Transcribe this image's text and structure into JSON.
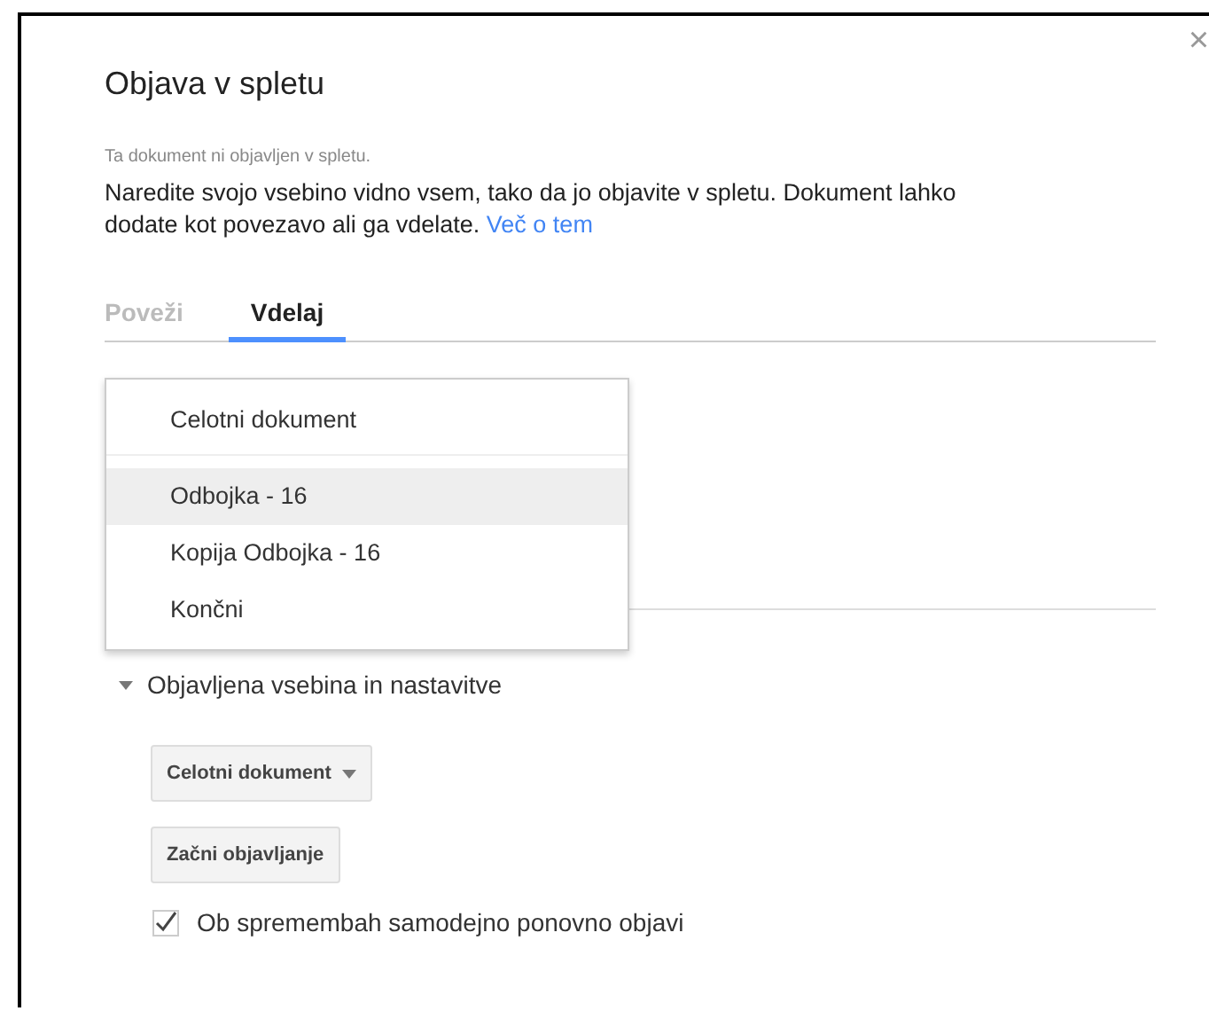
{
  "dialog": {
    "title": "Objava v spletu",
    "close": "×",
    "status": "Ta dokument ni objavljen v spletu.",
    "description": "Naredite svojo vsebino vidno vsem, tako da jo objavite v spletu. Dokument lahko dodate kot povezavo ali ga vdelate.",
    "link": "Več o tem"
  },
  "tabs": [
    {
      "label": "Poveži",
      "selected": false
    },
    {
      "label": "Vdelaj",
      "selected": true
    }
  ],
  "menu": {
    "items": [
      {
        "label": "Celotni dokument",
        "selected": false,
        "separator_after": true
      },
      {
        "label": "Odbojka - 16",
        "selected": true,
        "separator_after": false
      },
      {
        "label": "Kopija Odbojka - 16",
        "selected": false,
        "separator_after": false
      },
      {
        "label": "Končni",
        "selected": false,
        "separator_after": false
      }
    ]
  },
  "section": {
    "label": "Objavljena vsebina in nastavitve",
    "expanded": true,
    "dropdown": {
      "label": "Celotni dokument"
    },
    "button": "Začni objavljanje",
    "checkbox": {
      "label": "Ob spremembah samodejno ponovno objavi",
      "checked": true
    }
  }
}
